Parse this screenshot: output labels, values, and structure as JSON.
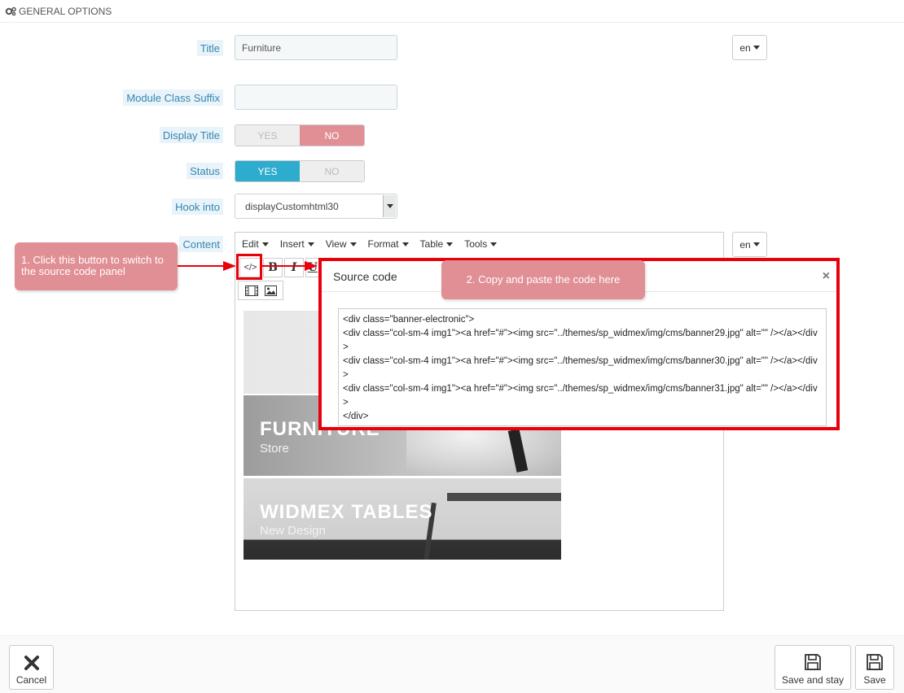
{
  "header": {
    "title": "GENERAL OPTIONS",
    "icon": "gears-icon"
  },
  "form": {
    "title_label": "Title",
    "title_value": "Furniture",
    "lang_code": "en",
    "suffix_label": "Module Class Suffix",
    "suffix_value": "",
    "display_title_label": "Display Title",
    "display_title_yes": "YES",
    "display_title_no": "NO",
    "display_title_selected": "NO",
    "status_label": "Status",
    "status_yes": "YES",
    "status_no": "NO",
    "status_selected": "YES",
    "hook_label": "Hook into",
    "hook_value": "displayCustomhtml30",
    "content_label": "Content"
  },
  "editor": {
    "menus": [
      "Edit",
      "Insert",
      "View",
      "Format",
      "Table",
      "Tools"
    ],
    "source_code_button": "</>",
    "bold": "B",
    "italic": "I",
    "underline": "U",
    "banners": [
      {
        "heading": "FURNITURE",
        "sub": "Store"
      },
      {
        "heading": "WIDMEX TABLES",
        "sub": "New Design"
      }
    ]
  },
  "modal": {
    "title": "Source code",
    "close": "×",
    "code": "<div class=\"banner-electronic\">\n<div class=\"col-sm-4 img1\"><a href=\"#\"><img src=\"../themes/sp_widmex/img/cms/banner29.jpg\" alt=\"\" /></a></div>\n<div class=\"col-sm-4 img1\"><a href=\"#\"><img src=\"../themes/sp_widmex/img/cms/banner30.jpg\" alt=\"\" /></a></div>\n<div class=\"col-sm-4 img1\"><a href=\"#\"><img src=\"../themes/sp_widmex/img/cms/banner31.jpg\" alt=\"\" /></a></div>\n</div>"
  },
  "callouts": {
    "step1": "1. Click this button to switch to the source code panel",
    "step2": "2. Copy and paste the code here"
  },
  "footer": {
    "cancel": "Cancel",
    "save_and_stay": "Save and stay",
    "save": "Save"
  },
  "colors": {
    "accent_red": "#e8000b",
    "switch_no_active": "#e08f95",
    "switch_yes_active": "#2eacce",
    "label_bg": "#e9f3fa",
    "label_text": "#3586ae"
  }
}
